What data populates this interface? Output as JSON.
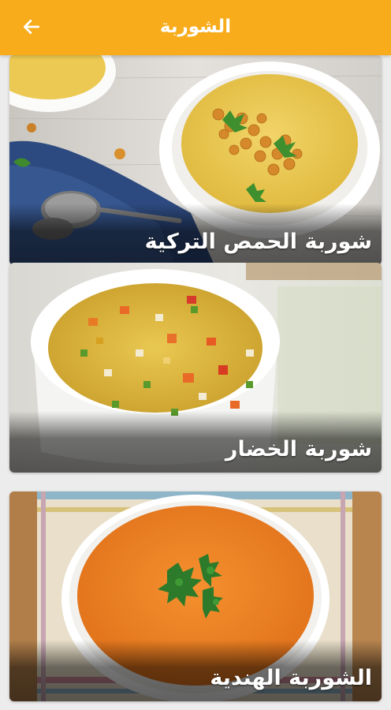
{
  "appbar": {
    "title": "الشوربة",
    "background": "#f8ac1c",
    "back_icon": "arrow-left-icon"
  },
  "recipes": [
    {
      "name": "شوربة الحمص التركية"
    },
    {
      "name": "شوربة الخضار"
    },
    {
      "name": "الشوربة الهندية"
    }
  ]
}
